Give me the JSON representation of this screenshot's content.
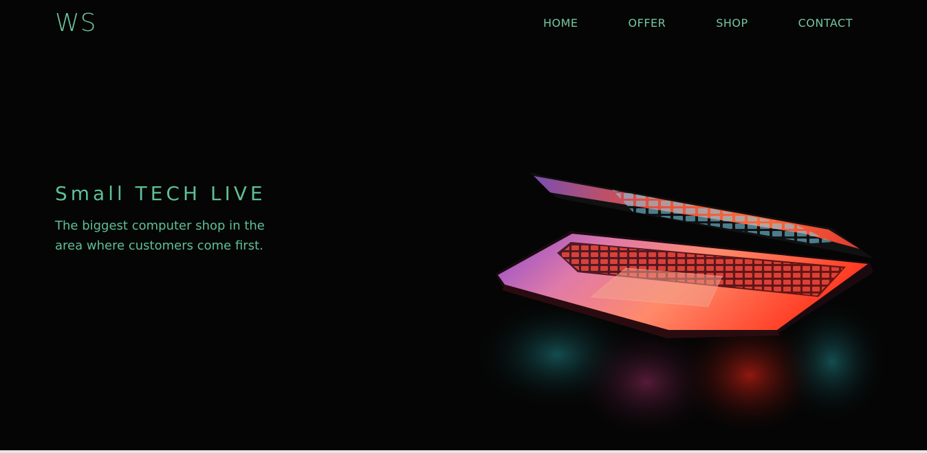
{
  "header": {
    "logo": "WS",
    "nav": [
      {
        "label": "HOME"
      },
      {
        "label": "OFFER"
      },
      {
        "label": "SHOP"
      },
      {
        "label": "CONTACT"
      }
    ]
  },
  "hero": {
    "title": "Small TECH LIVE",
    "subtitle": "The biggest computer shop in the area where customers come first."
  },
  "colors": {
    "background": "#050505",
    "accent": "#5ec095"
  },
  "image": {
    "subject": "laptop-hero-image"
  }
}
